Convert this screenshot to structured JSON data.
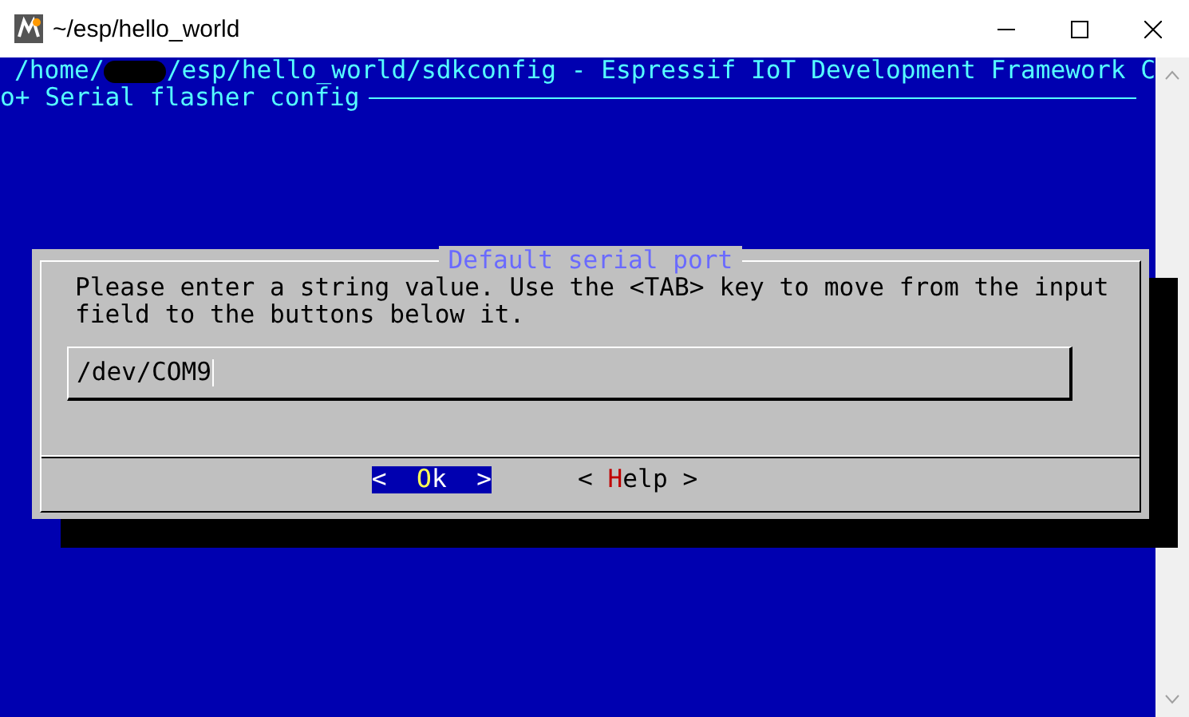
{
  "window": {
    "title": "~/esp/hello_world"
  },
  "terminal": {
    "header_start": "/home/",
    "header_end": "/esp/hello_world/sdkconfig - Espressif IoT Development Framework C",
    "breadcrumb": "o+ Serial flasher config"
  },
  "dialog": {
    "title": "Default serial port",
    "message": "Please enter a string value. Use the <TAB> key to move from the input field to the buttons below it.",
    "input": {
      "value": "/dev/COM9"
    },
    "buttons": [
      {
        "left": "<",
        "hotkey": "O",
        "rest": "k",
        "right": ">",
        "selected": true
      },
      {
        "left": "<",
        "hotkey": "H",
        "rest": "elp",
        "right": ">",
        "selected": false
      }
    ]
  }
}
